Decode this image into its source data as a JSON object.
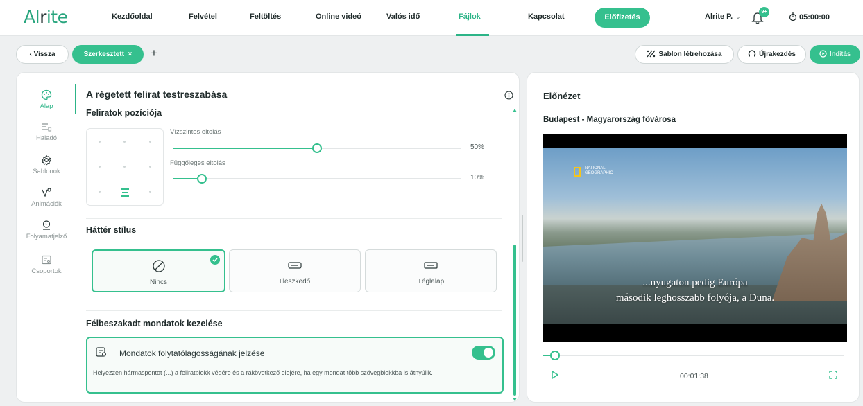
{
  "brand": {
    "logo_text_a": "Al",
    "logo_text_b": "r",
    "logo_text_c": "ite",
    "accent": "#35c08e"
  },
  "nav": {
    "items": [
      {
        "label": "Kezdőoldal"
      },
      {
        "label": "Felvétel"
      },
      {
        "label": "Feltöltés"
      },
      {
        "label": "Online videó"
      },
      {
        "label": "Valós idő"
      },
      {
        "label": "Fájlok",
        "active": true
      },
      {
        "label": "Kapcsolat"
      }
    ],
    "subscribe_label": "Előfizetés",
    "user_label": "Alrite P.",
    "user_chevron": "⌄",
    "notification_badge": "9+",
    "timer": "05:00:00"
  },
  "toolbar": {
    "back_label": "‹  Vissza",
    "tab_label": "Szerkesztett",
    "tab_close": "×",
    "add_label": "+",
    "template_label": "Sablon létrehozása",
    "restart_label": "Újrakezdés",
    "start_label": "Indítás"
  },
  "sidebar": {
    "items": [
      {
        "label": "Alap",
        "icon": "palette-icon",
        "active": true
      },
      {
        "label": "Haladó",
        "icon": "advanced-icon"
      },
      {
        "label": "Sablonok",
        "icon": "gear-icon"
      },
      {
        "label": "Animációk",
        "icon": "animation-icon"
      },
      {
        "label": "Folyamatjelző",
        "icon": "progress-icon"
      },
      {
        "label": "Csoportok",
        "icon": "groups-icon"
      }
    ]
  },
  "editor": {
    "title": "A régetett felirat testreszabása",
    "position_section": "Feliratok pozíciója",
    "horizontal_label": "Vízszintes eltolás",
    "horizontal_value": 50,
    "horizontal_pct": "50%",
    "vertical_label": "Függőleges eltolás",
    "vertical_value": 10,
    "vertical_pct": "10%",
    "background_section": "Háttér stílus",
    "styles": [
      {
        "label": "Nincs",
        "icon": "none-icon",
        "selected": true
      },
      {
        "label": "Illeszkedő",
        "icon": "fit-box-icon"
      },
      {
        "label": "Téglalap",
        "icon": "rectangle-box-icon"
      }
    ],
    "broken_section": "Félbeszakadt mondatok kezelése",
    "option_title": "Mondatok folytatólagosságának jelzése",
    "option_enabled": true,
    "option_desc": "Helyezzen hármaspontot (...) a feliratblokk végére és a rákövetkező elejére, ha egy mondat több szövegblokkba is átnyúlik."
  },
  "preview": {
    "title": "Előnézet",
    "video_title": "Budapest - Magyarország fővárosa",
    "watermark_line1": "NATIONAL",
    "watermark_line2": "GEOGRAPHIC",
    "caption_line1": "...nyugaton pedig Európa",
    "caption_line2": "második leghosszabb folyója, a Duna.",
    "progress": 0.04,
    "time": "00:01:38"
  }
}
